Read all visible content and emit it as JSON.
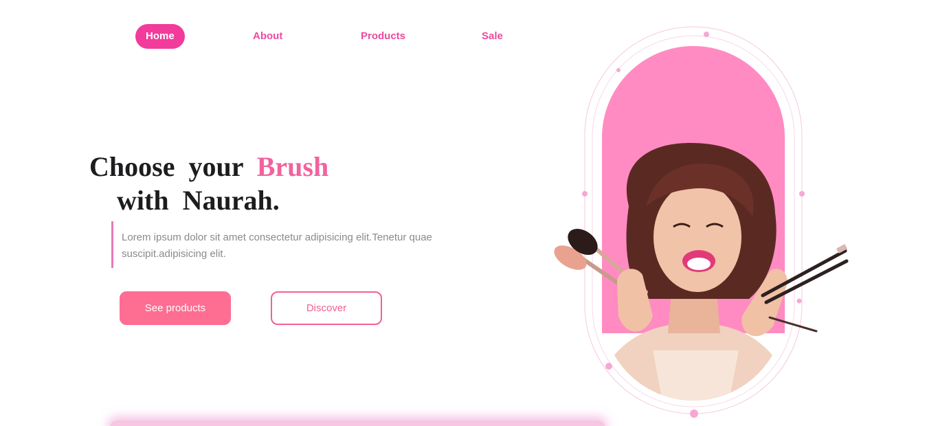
{
  "nav": {
    "items": [
      {
        "label": "Home",
        "active": true
      },
      {
        "label": "About",
        "active": false
      },
      {
        "label": "Products",
        "active": false
      },
      {
        "label": "Sale",
        "active": false
      }
    ]
  },
  "hero": {
    "headline_part1": "Choose your",
    "headline_accent": "Brush",
    "headline_line2": "with Naurah.",
    "description": "Lorem ipsum dolor sit amet consectetur adipisicing elit.Tenetur quae suscipit.adipisicing elit.",
    "primary_button": "See products",
    "secondary_button": "Discover"
  },
  "theme": {
    "accent": "#f23b9a",
    "accent_soft": "#ff8bc2",
    "button": "#fe6d92",
    "text_dark": "#1d1d1f",
    "text_muted": "#8a8a8a"
  },
  "icons": [
    "woman-with-makeup-brushes-illustration"
  ]
}
